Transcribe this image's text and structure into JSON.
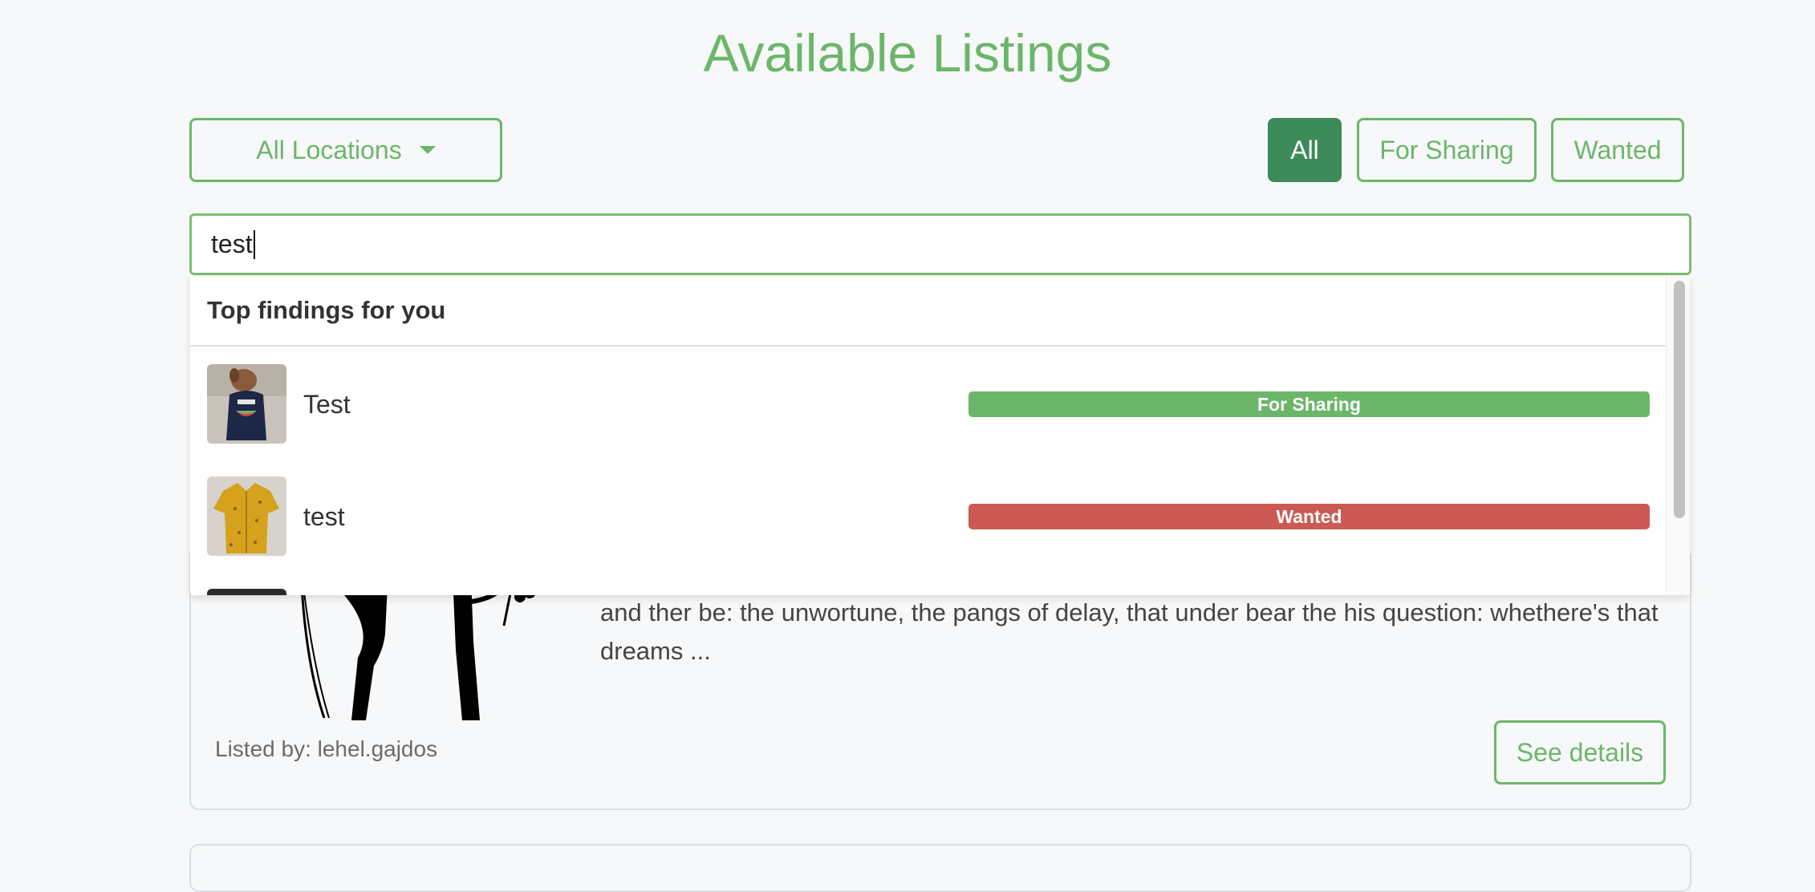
{
  "page": {
    "title": "Available Listings"
  },
  "filters": {
    "location_label": "All Locations",
    "type_buttons": [
      "All",
      "For Sharing",
      "Wanted"
    ],
    "active_type": "All"
  },
  "search": {
    "value": "test"
  },
  "dropdown": {
    "heading": "Top findings for you",
    "results": [
      {
        "name": "Test",
        "badge": "For Sharing",
        "badge_color": "#6cb66a",
        "thumb_icon": "dog-in-shirt-photo"
      },
      {
        "name": "test",
        "badge": "Wanted",
        "badge_color": "#cc5a54",
        "thumb_icon": "yellow-shirt-photo"
      }
    ],
    "scroll_position_fraction": 0.0
  },
  "listing_card": {
    "description": "and ther be: the unwortune, the pangs of delay, that under bear the his question: whethere's that dreams ...",
    "listed_by": "Listed by: lehel.gajdos",
    "details_label": "See details",
    "image_icon": "couple-silhouette-illustration"
  },
  "colors": {
    "brand_green": "#6cb66a",
    "active_green": "#3d8a5a",
    "wanted_red": "#cc5a54"
  }
}
